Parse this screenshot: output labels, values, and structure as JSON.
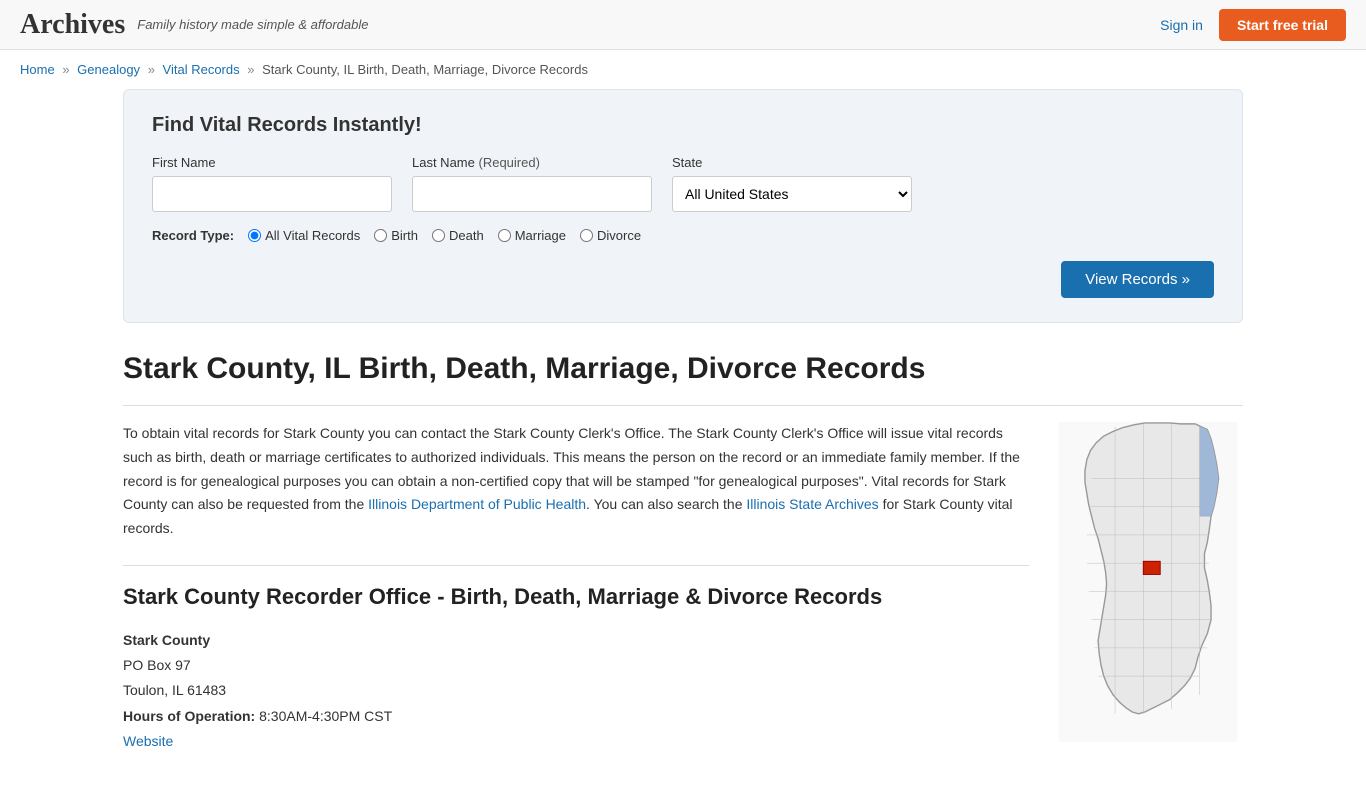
{
  "header": {
    "logo": "Archives",
    "tagline": "Family history made simple & affordable",
    "signin_label": "Sign in",
    "trial_label": "Start free trial"
  },
  "breadcrumb": {
    "home": "Home",
    "genealogy": "Genealogy",
    "vital_records": "Vital Records",
    "current": "Stark County, IL Birth, Death, Marriage, Divorce Records"
  },
  "search": {
    "title": "Find Vital Records Instantly!",
    "first_name_label": "First Name",
    "last_name_label": "Last Name",
    "last_name_required": "(Required)",
    "state_label": "State",
    "state_value": "All United States",
    "record_type_label": "Record Type:",
    "record_types": [
      "All Vital Records",
      "Birth",
      "Death",
      "Marriage",
      "Divorce"
    ],
    "view_records_label": "View Records »"
  },
  "page": {
    "title": "Stark County, IL Birth, Death, Marriage, Divorce Records",
    "description_1": "To obtain vital records for Stark County you can contact the Stark County Clerk's Office. The Stark County Clerk's Office will issue vital records such as birth, death or marriage certificates to authorized individuals. This means the person on the record or an immediate family member. If the record is for genealogical purposes you can obtain a non-certified copy that will be stamped \"for genealogical purposes\". Vital records for Stark County can also be requested from the Illinois Department of Public Health. You can also search the Illinois State Archives for Stark County vital records.",
    "illinois_dept_link": "Illinois Department of Public Health",
    "illinois_archives_link": "Illinois State Archives"
  },
  "recorder": {
    "section_title": "Stark County Recorder Office - Birth, Death, Marriage & Divorce Records",
    "office_name": "Stark County",
    "address_line1": "PO Box 97",
    "address_line2": "Toulon, IL 61483",
    "hours_label": "Hours of Operation:",
    "hours_value": "8:30AM-4:30PM CST",
    "website_label": "Website"
  }
}
